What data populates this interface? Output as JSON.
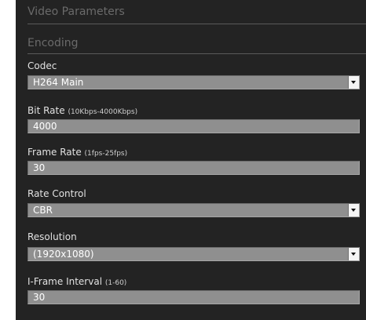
{
  "sections": {
    "video_parameters": "Video Parameters",
    "encoding": "Encoding"
  },
  "codec": {
    "label": "Codec",
    "value": "H264 Main"
  },
  "bit_rate": {
    "label": "Bit Rate",
    "hint": "(10Kbps-4000Kbps)",
    "value": "4000"
  },
  "frame_rate": {
    "label": "Frame Rate",
    "hint": "(1fps-25fps)",
    "value": "30"
  },
  "rate_control": {
    "label": "Rate Control",
    "value": "CBR"
  },
  "resolution": {
    "label": "Resolution",
    "value": "(1920x1080)"
  },
  "iframe_interval": {
    "label": "I-Frame Interval",
    "hint": "(1-60)",
    "value": "30"
  },
  "icons": {
    "dropdown": "chevron-down-icon"
  },
  "colors": {
    "panel_background": "#232323",
    "field_background": "#8f8f8f",
    "section_text": "#6a6a6a"
  }
}
